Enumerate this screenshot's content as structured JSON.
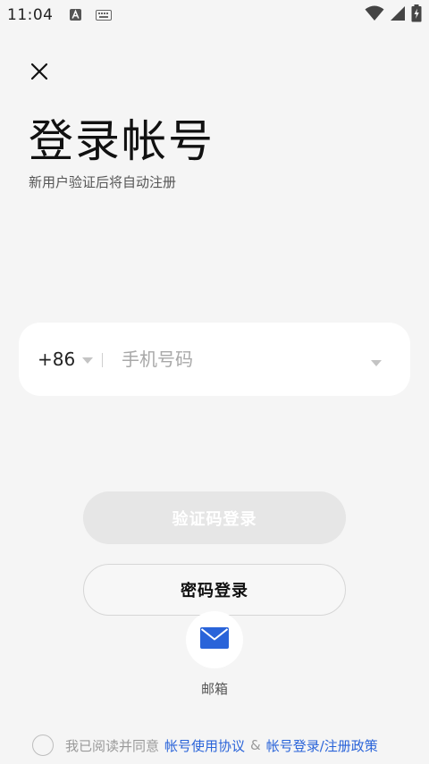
{
  "status_bar": {
    "time": "11:04",
    "icons": [
      "a-letter-icon",
      "keyboard-icon",
      "wifi-icon",
      "signal-icon",
      "battery-charging-icon"
    ]
  },
  "header": {
    "close_icon": "close-icon",
    "title": "登录帐号",
    "subtitle": "新用户验证后将自动注册"
  },
  "phone_form": {
    "country_code": "+86",
    "phone_placeholder": "手机号码",
    "phone_value": ""
  },
  "actions": {
    "sms_login_label": "验证码登录",
    "password_login_label": "密码登录"
  },
  "other_login": {
    "email_icon": "mail-icon",
    "email_label": "邮箱"
  },
  "agreement": {
    "prefix": "我已阅读并同意",
    "terms_link": "帐号使用协议",
    "joiner": "&",
    "policy_link": "帐号登录/注册政策"
  },
  "colors": {
    "background": "#f5f5f5",
    "accent_blue": "#2a64d9",
    "disabled_button": "#e6e6e6",
    "card": "#ffffff"
  }
}
